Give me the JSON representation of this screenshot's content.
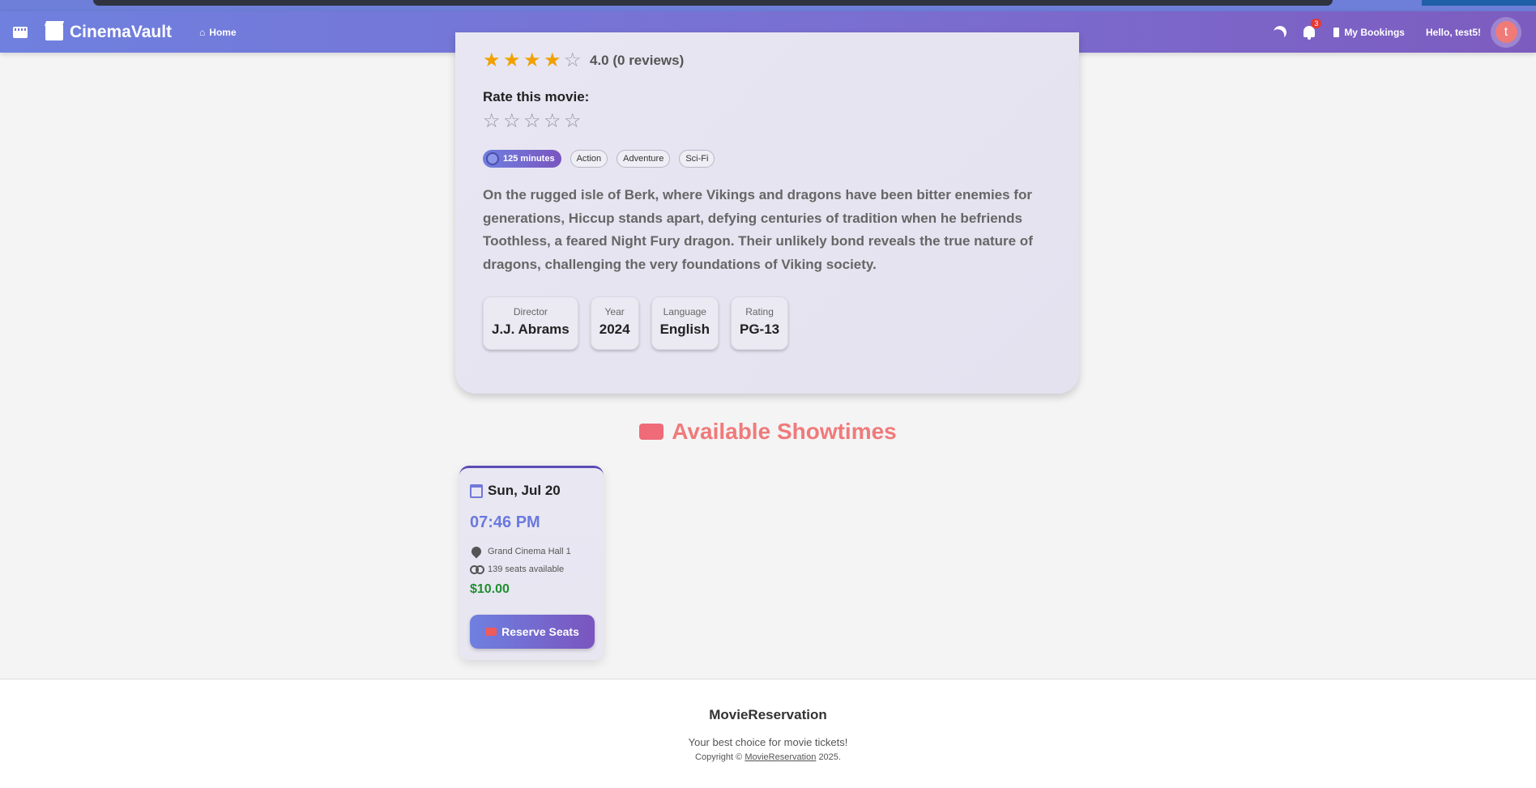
{
  "navbar": {
    "brand": "CinemaVault",
    "home_label": "Home",
    "home_glyph": "⌂",
    "notifications_count": "3",
    "bookings_label": "My Bookings",
    "greeting": "Hello, test5!",
    "avatar_initial": "t"
  },
  "movie": {
    "rating_value": 4,
    "rating_text": "4.0 (0 reviews)",
    "rate_label": "Rate this movie:",
    "duration": "125 minutes",
    "genres": [
      "Action",
      "Adventure",
      "Sci-Fi"
    ],
    "description": "On the rugged isle of Berk, where Vikings and dragons have been bitter enemies for generations, Hiccup stands apart, defying centuries of tradition when he befriends Toothless, a feared Night Fury dragon. Their unlikely bond reveals the true nature of dragons, challenging the very foundations of Viking society.",
    "meta": [
      {
        "label": "Director",
        "value": "J.J. Abrams"
      },
      {
        "label": "Year",
        "value": "2024"
      },
      {
        "label": "Language",
        "value": "English"
      },
      {
        "label": "Rating",
        "value": "PG-13"
      }
    ]
  },
  "showtimes": {
    "heading": "Available Showtimes",
    "items": [
      {
        "date": "Sun, Jul 20",
        "time": "07:46 PM",
        "hall": "Grand Cinema Hall 1",
        "seats": "139 seats available",
        "price": "$10.00",
        "button_label": "Reserve Seats"
      }
    ]
  },
  "footer": {
    "title": "MovieReservation",
    "tagline": "Your best choice for movie tickets!",
    "copyright_prefix": "Copyright ©",
    "copyright_link": "MovieReservation",
    "copyright_year": "2025."
  },
  "colors": {
    "accent": "#6f80de",
    "accent_dark": "#7d5cbf",
    "star": "#f0a000",
    "price": "#1f8f2f",
    "heading": "#f07a7a"
  },
  "icons": [
    "film-icon",
    "clapperboard-icon",
    "home-icon",
    "moon-icon",
    "bell-icon",
    "ticket-icon",
    "clock-icon",
    "calendar-icon",
    "location-pin-icon",
    "people-icon",
    "star-icon"
  ]
}
